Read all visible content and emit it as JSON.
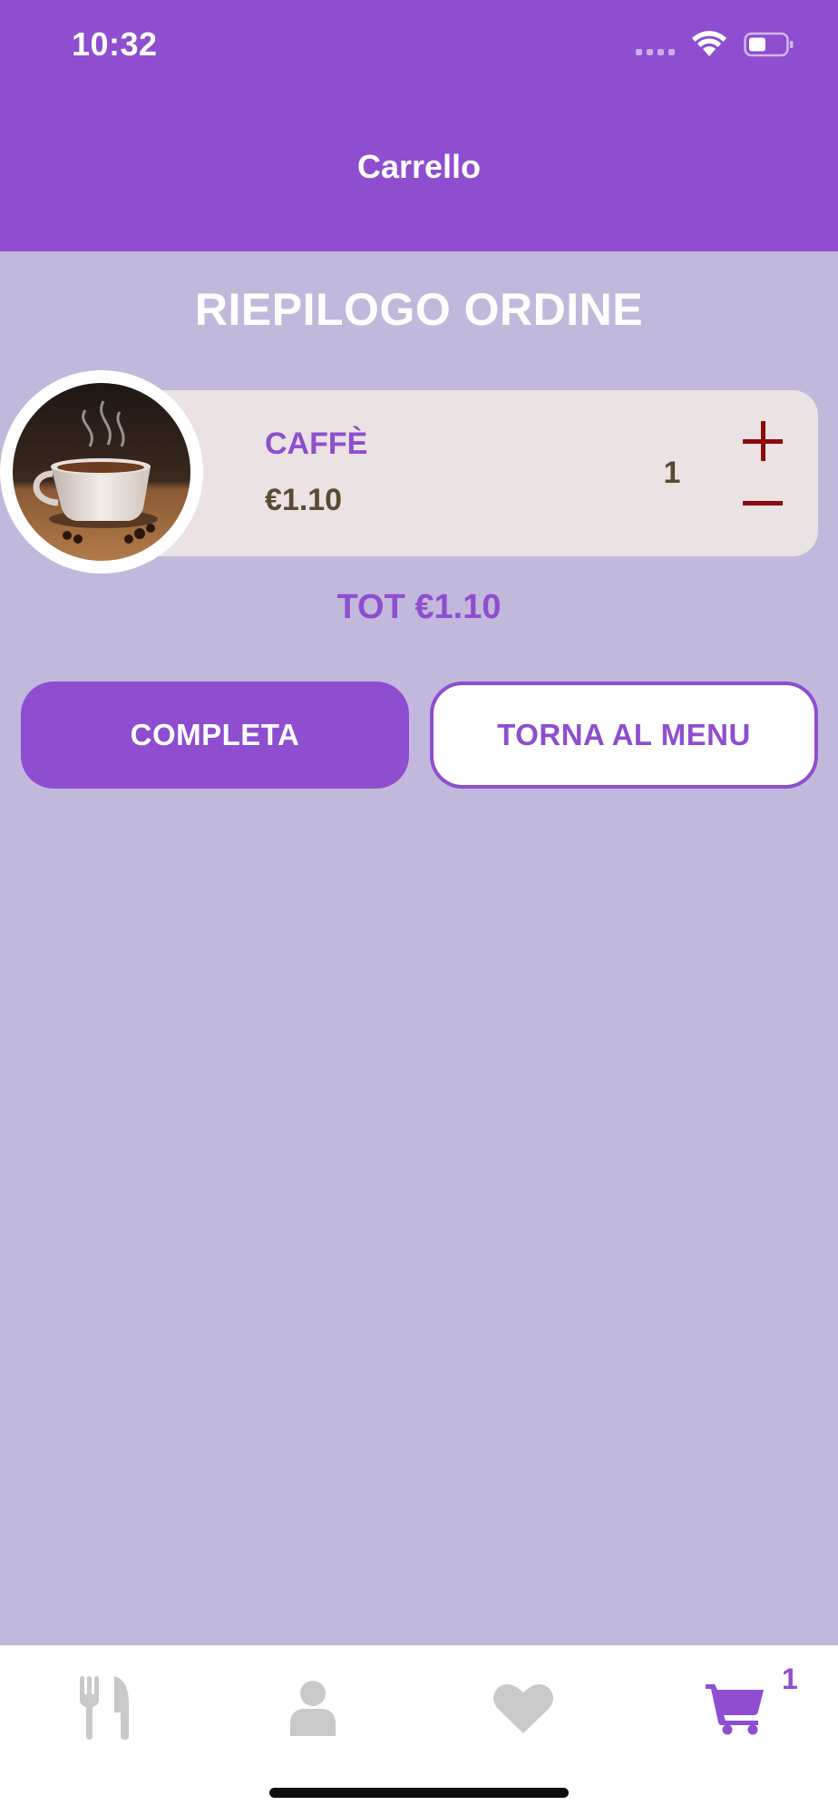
{
  "status_bar": {
    "time": "10:32"
  },
  "header": {
    "title": "Carrello"
  },
  "section": {
    "title": "RIEPILOGO ORDINE"
  },
  "cart": {
    "items": [
      {
        "name": "CAFFÈ",
        "price": "€1.10",
        "quantity": "1",
        "image": "coffee-cup-image"
      }
    ],
    "total": "TOT €1.10"
  },
  "actions": {
    "complete_label": "COMPLETA",
    "back_label": "TORNA AL MENU"
  },
  "tabbar": {
    "tabs": [
      {
        "name": "menu",
        "icon": "fork-knife-icon",
        "active": false
      },
      {
        "name": "profile",
        "icon": "user-icon",
        "active": false
      },
      {
        "name": "favorites",
        "icon": "heart-icon",
        "active": false
      },
      {
        "name": "cart",
        "icon": "cart-icon",
        "active": true
      }
    ],
    "cart_badge": "1"
  },
  "colors": {
    "primary": "#8E4ECF",
    "background": "#C2B8DC",
    "card": "#EBE2E3",
    "price": "#5B4A32",
    "qty_control": "#8B0A0A",
    "tab_inactive": "#C9C9C9"
  }
}
